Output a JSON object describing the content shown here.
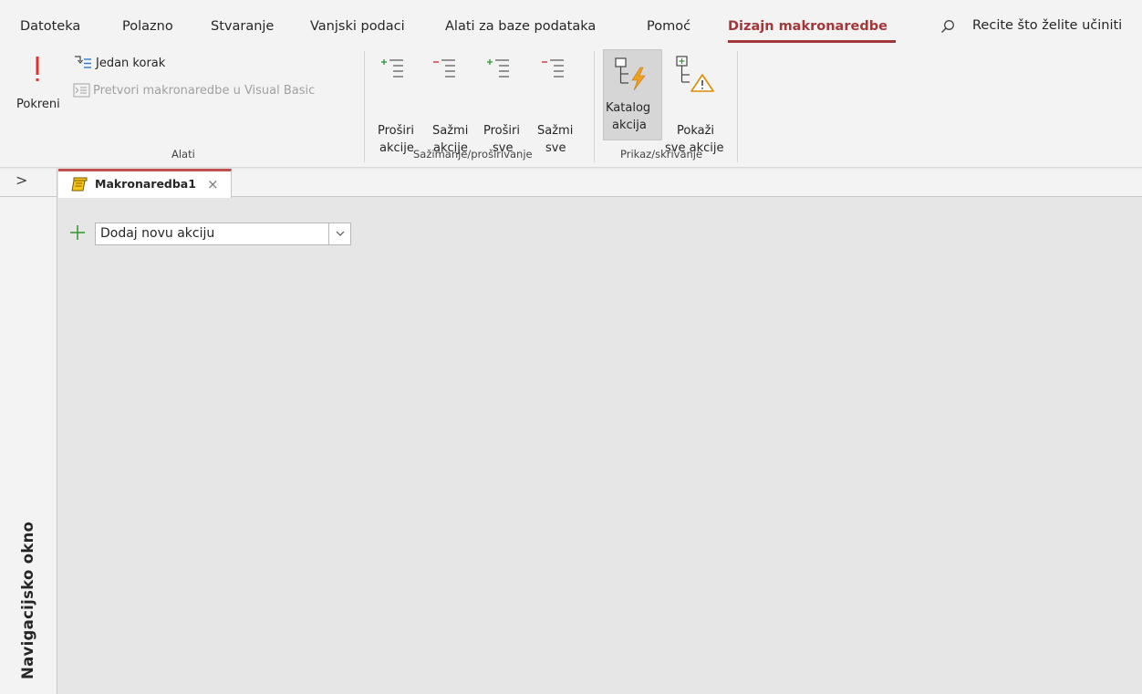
{
  "tabs": {
    "items": [
      "Datoteka",
      "Polazno",
      "Stvaranje",
      "Vanjski podaci",
      "Alati za baze podataka",
      "Pomoć",
      "Dizajn makronaredbe"
    ],
    "active": "Dizajn makronaredbe",
    "search_text": "Recite što želite učiniti"
  },
  "ribbon": {
    "alati": {
      "label": "Alati",
      "run_label": "Pokreni",
      "single_step_label": "Jedan korak",
      "convert_label": "Pretvori makronaredbe u Visual Basic"
    },
    "collapse_expand": {
      "label": "Sažimanje/proširivanje",
      "expand_actions": [
        "Proširi",
        "akcije"
      ],
      "collapse_actions": [
        "Sažmi",
        "akcije"
      ],
      "expand_all": [
        "Proširi",
        "sve"
      ],
      "collapse_all": [
        "Sažmi",
        "sve"
      ]
    },
    "show_hide": {
      "label": "Prikaz/skrivanje",
      "action_catalog": [
        "Katalog",
        "akcija"
      ],
      "show_all_actions": [
        "Pokaži",
        "sve akcije"
      ]
    }
  },
  "nav_pane": {
    "title": "Navigacijsko okno",
    "toggle_glyph": ">"
  },
  "document": {
    "tab_title": "Makronaredba1",
    "close_glyph": "×",
    "add_action_placeholder": "Dodaj novu akciju"
  },
  "colors": {
    "accent": "#a4373a",
    "add_green": "#3a9a3a",
    "minus_red": "#d13438",
    "lightning_orange": "#f0a020"
  }
}
